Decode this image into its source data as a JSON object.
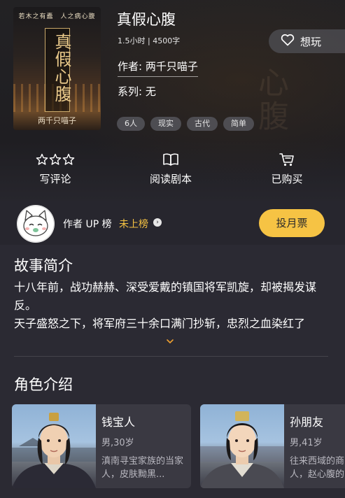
{
  "hero": {
    "cover": {
      "tagline": "若木之有蠹　人之病心腹",
      "title": "真假心腹",
      "author": "两千只喵子"
    },
    "title": "真假心腹",
    "meta": "1.5小时 | 4500字",
    "author_line": "作者: 两千只喵子",
    "series_line": "系列: 无",
    "want_label": "想玩",
    "tags": [
      "6人",
      "现实",
      "古代",
      "简单"
    ],
    "watermark": "心腹",
    "actions": [
      {
        "label": "写评论",
        "icon": "three-stars-icon"
      },
      {
        "label": "阅读剧本",
        "icon": "open-book-icon"
      },
      {
        "label": "已购买",
        "icon": "cart-icon"
      }
    ]
  },
  "upbar": {
    "label": "作者 UP 榜",
    "status": "未上榜",
    "vote_label": "投月票"
  },
  "intro": {
    "title": "故事简介",
    "lines": [
      "十八年前，战功赫赫、深受爱戴的镇国将军凯旋，却被揭发谋反。",
      "天子盛怒之下，将军府三十余口满门抄斩，忠烈之血染红了"
    ]
  },
  "characters": {
    "title": "角色介绍",
    "items": [
      {
        "name": "钱宝人",
        "meta": "男,30岁",
        "desc": "滇南寻宝家族的当家人，皮肤黝黑..."
      },
      {
        "name": "孙朋友",
        "meta": "男,41岁",
        "desc": "往来西域的商人，赵心腹的"
      }
    ]
  },
  "colors": {
    "accent": "#f6c344",
    "status_gold": "#f5c242",
    "background": "#2b2a33"
  }
}
